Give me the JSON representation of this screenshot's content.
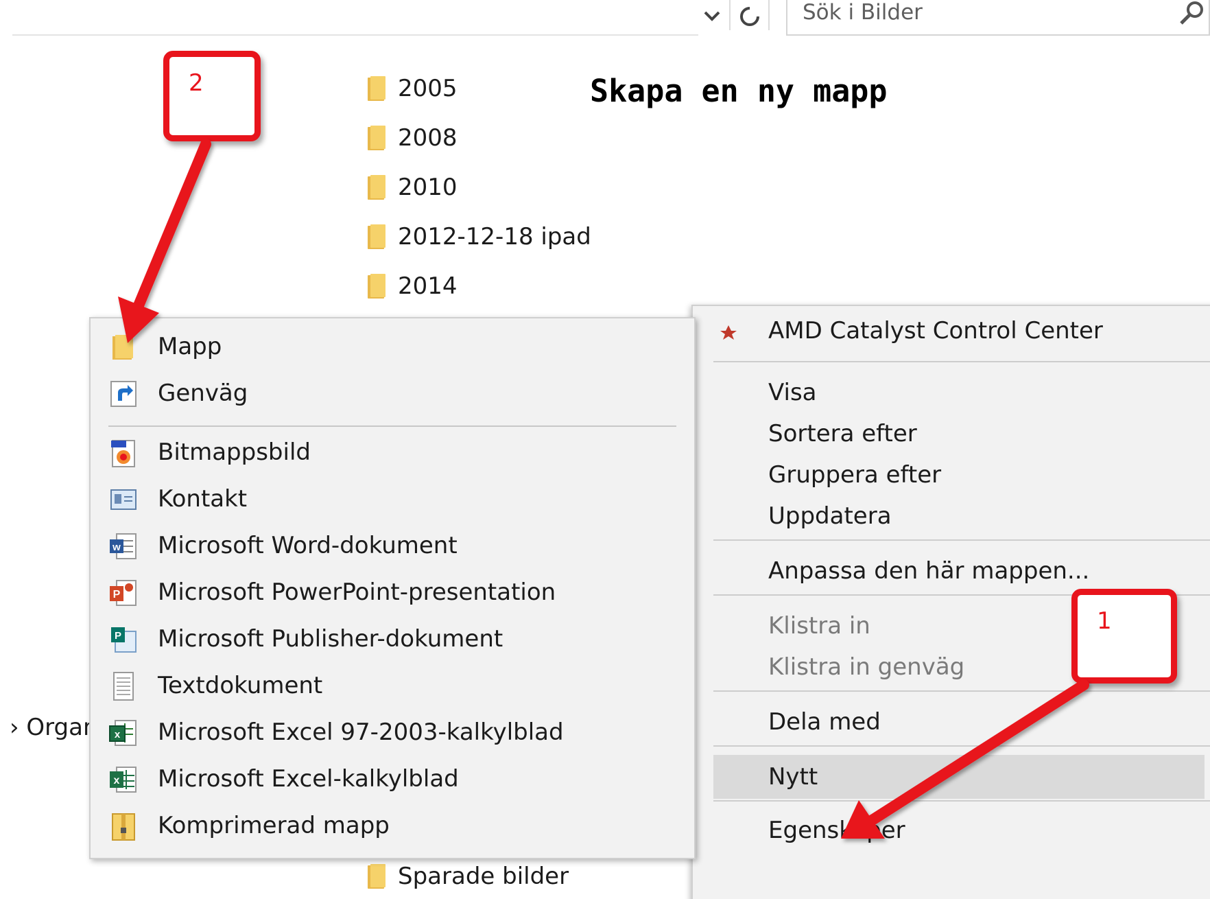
{
  "search": {
    "placeholder": "Sök i Bilder"
  },
  "title": "Skapa en ny mapp",
  "folders": [
    "2005",
    "2008",
    "2010",
    "2012-12-18 ipad",
    "2014",
    "Sparade bilder"
  ],
  "left_partial": "› Organ",
  "context_menu": {
    "items": [
      {
        "label": "AMD Catalyst Control Center",
        "icon": "amd-icon"
      },
      {
        "label": "Visa",
        "submenu": true
      },
      {
        "label": "Sortera efter",
        "submenu": true
      },
      {
        "label": "Gruppera efter",
        "submenu": true
      },
      {
        "label": "Uppdatera"
      },
      {
        "label": "Anpassa den här mappen..."
      },
      {
        "label": "Klistra in",
        "disabled": true
      },
      {
        "label": "Klistra in genväg",
        "disabled": true
      },
      {
        "label": "Dela med",
        "submenu": true
      },
      {
        "label": "Nytt",
        "submenu": true,
        "highlighted": true
      },
      {
        "label": "Egenskaper"
      }
    ]
  },
  "new_submenu": {
    "items": [
      {
        "label": "Mapp",
        "icon": "folder-icon"
      },
      {
        "label": "Genväg",
        "icon": "shortcut-icon"
      },
      {
        "label": "Bitmappsbild",
        "icon": "bitmap-icon"
      },
      {
        "label": "Kontakt",
        "icon": "contact-icon"
      },
      {
        "label": "Microsoft Word-dokument",
        "icon": "word-icon"
      },
      {
        "label": "Microsoft PowerPoint-presentation",
        "icon": "powerpoint-icon"
      },
      {
        "label": "Microsoft Publisher-dokument",
        "icon": "publisher-icon"
      },
      {
        "label": "Textdokument",
        "icon": "text-document-icon"
      },
      {
        "label": "Microsoft Excel 97-2003-kalkylblad",
        "icon": "excel-legacy-icon"
      },
      {
        "label": "Microsoft Excel-kalkylblad",
        "icon": "excel-icon"
      },
      {
        "label": "Komprimerad mapp",
        "icon": "zip-folder-icon"
      }
    ]
  },
  "annotations": {
    "step1": "1",
    "step2": "2"
  },
  "colors": {
    "annotation_red": "#e8141c",
    "folder_yellow": "#f6d26a",
    "menu_bg": "#f2f2f2",
    "menu_hover": "#dadada"
  }
}
